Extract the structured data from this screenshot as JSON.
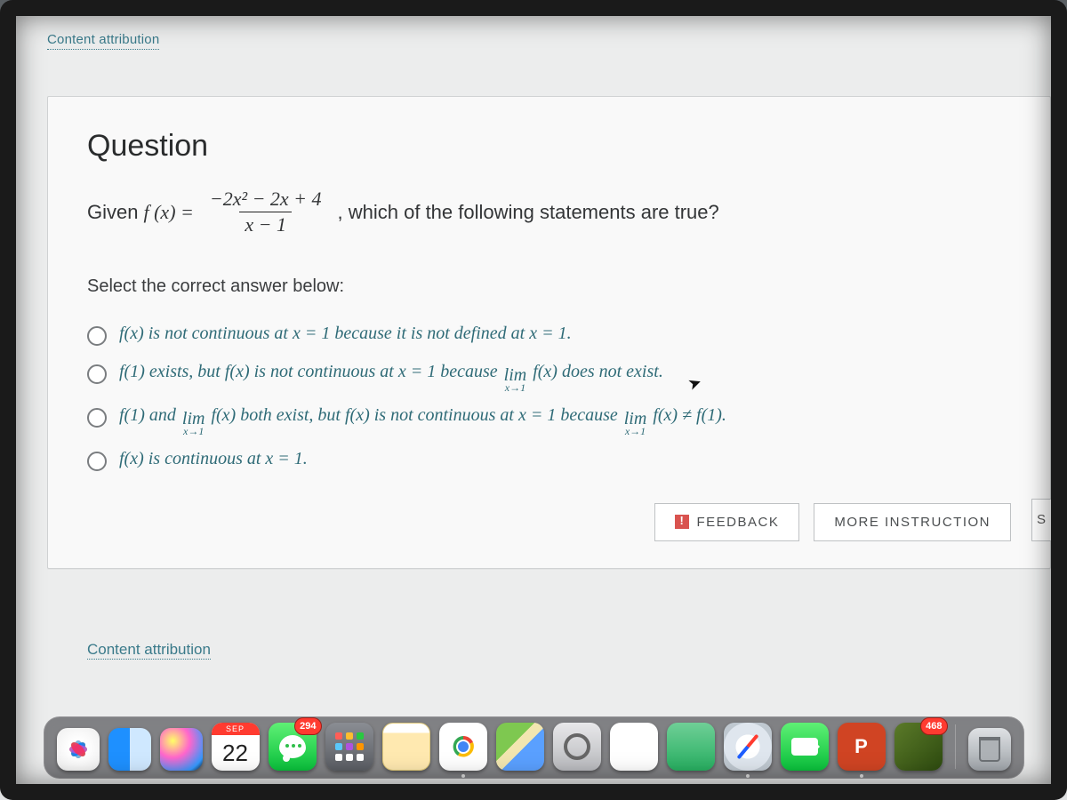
{
  "top_link": "Content attribution",
  "question": {
    "title": "Question",
    "stem_prefix": "Given",
    "stem_func": "f (x) =",
    "numerator": "−2x² − 2x + 4",
    "denominator": "x − 1",
    "stem_suffix": ", which of the following statements are true?",
    "prompt": "Select the correct answer below:",
    "options": {
      "a": "f(x) is not continuous at x = 1 because it is not defined at x = 1.",
      "b_pre": "f(1) exists, but f(x) is not continuous at x = 1 because ",
      "b_post": " f(x) does not exist.",
      "c_pre": "f(1) and ",
      "c_mid": " f(x) both exist, but f(x) is not continuous at x = 1 because ",
      "c_post": " f(x) ≠ f(1).",
      "d": "f(x) is continuous at x = 1.",
      "lim_label": "lim",
      "lim_sub": "x→1"
    },
    "feedback_btn": "FEEDBACK",
    "more_btn": "MORE INSTRUCTION",
    "side_btn": "S"
  },
  "bottom_link": "Content attribution",
  "dock": {
    "calendar_month": "SEP",
    "calendar_day": "22",
    "messages_badge": "294",
    "eagle_badge": "468",
    "ppt_letter": "P"
  }
}
